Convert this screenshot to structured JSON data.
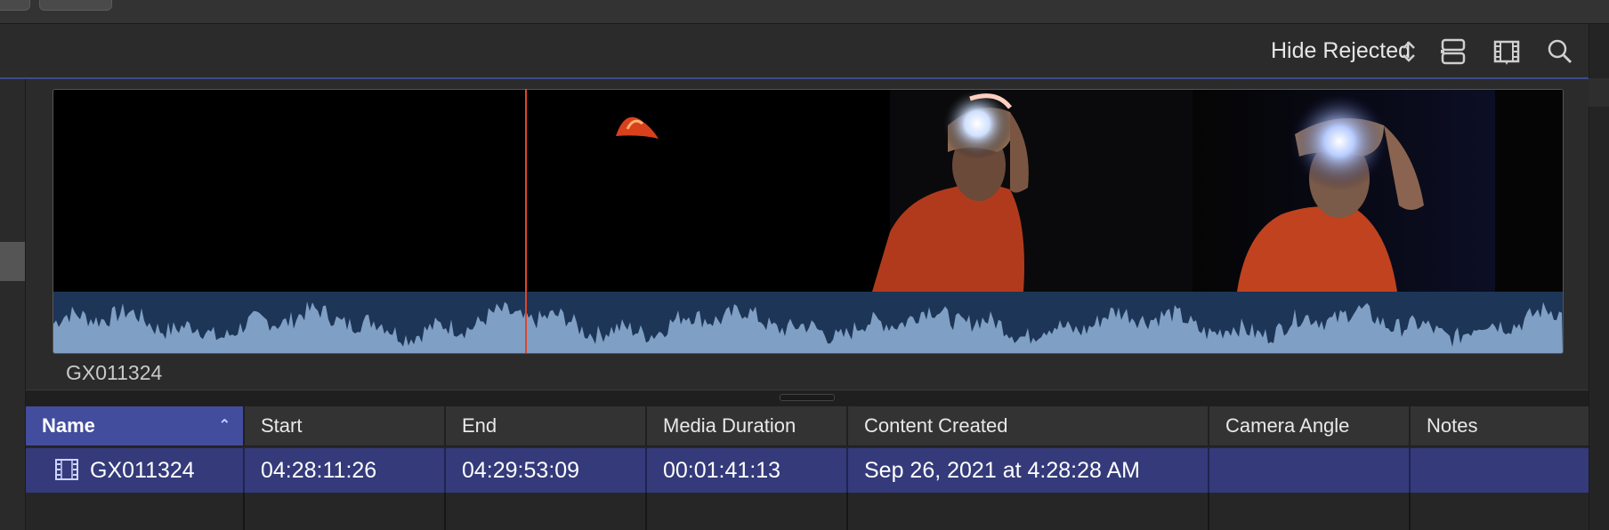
{
  "toolbar": {
    "filter_label": "Hide Rejected",
    "icons": [
      "chevron-updown-icon",
      "clip-appearance-icon",
      "filmstrip-icon",
      "search-icon"
    ]
  },
  "filmstrip": {
    "clip_name": "GX011324"
  },
  "table": {
    "columns": [
      {
        "label": "Name"
      },
      {
        "label": "Start"
      },
      {
        "label": "End"
      },
      {
        "label": "Media Duration"
      },
      {
        "label": "Content Created"
      },
      {
        "label": "Camera Angle"
      },
      {
        "label": "Notes"
      }
    ],
    "sorted_column": "Name",
    "sort_direction": "ascending",
    "rows": [
      {
        "name": "GX011324",
        "start": "04:28:11:26",
        "end": "04:29:53:09",
        "media_duration": "00:01:41:13",
        "content_created": "Sep 26, 2021 at 4:28:28 AM",
        "camera_angle": "",
        "notes": ""
      }
    ]
  },
  "colors": {
    "selection": "#343a7a",
    "sorted_header": "#434d9e",
    "playhead": "#e0452b",
    "waveform": "#7f9fc4"
  }
}
